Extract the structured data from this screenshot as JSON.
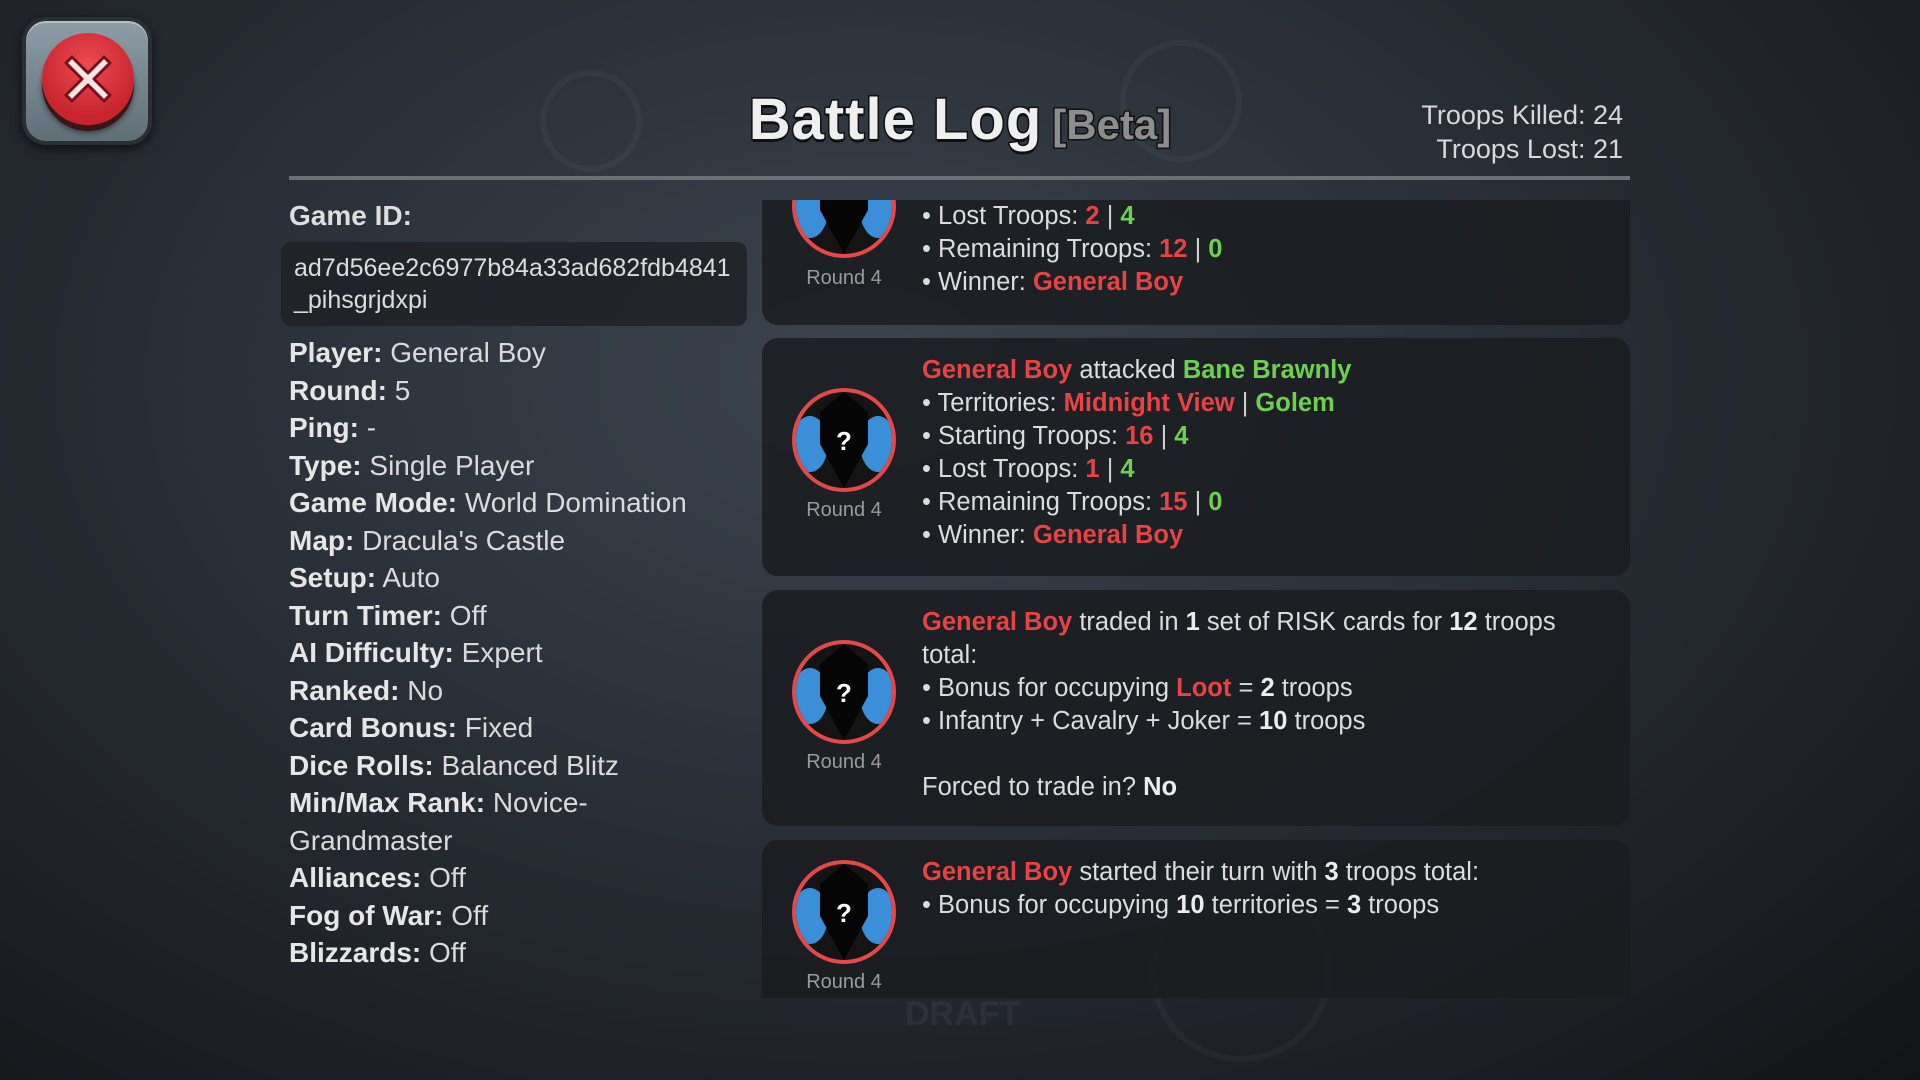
{
  "header": {
    "title": "Battle Log",
    "badge": "[Beta]",
    "troops_killed": "Troops Killed: 24",
    "troops_lost": "Troops Lost: 21"
  },
  "close_button": {
    "icon": "close-icon",
    "label": "Close"
  },
  "game": {
    "id_label": "Game ID:",
    "id_value": "ad7d56ee2c6977b84a33ad682fdb4841_pihsgrjdxpi",
    "info": [
      {
        "label": "Player:",
        "value": "General Boy"
      },
      {
        "label": "Round:",
        "value": "5"
      },
      {
        "label": "Ping:",
        "value": "-"
      },
      {
        "label": "Type:",
        "value": "Single Player"
      },
      {
        "label": "Game Mode:",
        "value": "World Domination"
      },
      {
        "label": "Map:",
        "value": "Dracula's Castle"
      },
      {
        "label": "Setup:",
        "value": "Auto"
      },
      {
        "label": "Turn Timer:",
        "value": "Off"
      },
      {
        "label": "AI Difficulty:",
        "value": "Expert"
      },
      {
        "label": "Ranked:",
        "value": "No"
      },
      {
        "label": "Card Bonus:",
        "value": "Fixed"
      },
      {
        "label": "Dice Rolls:",
        "value": "Balanced Blitz"
      },
      {
        "label": "Min/Max Rank:",
        "value": "Novice-Grandmaster"
      },
      {
        "label": "Alliances:",
        "value": "Off"
      },
      {
        "label": "Fog of War:",
        "value": "Off"
      },
      {
        "label": "Blizzards:",
        "value": "Off"
      }
    ]
  },
  "colors": {
    "attacker": "#e84343",
    "defender": "#6cd14f",
    "avatar_ring": "#e44848"
  },
  "log": {
    "entries": [
      {
        "round": "Round 4",
        "lost_label": "• Lost Troops: ",
        "lost_a": "2",
        "lost_b": "4",
        "remaining_label": "• Remaining Troops: ",
        "remaining_a": "12",
        "remaining_b": "0",
        "winner_label": "• Winner: ",
        "winner": "General Boy"
      },
      {
        "round": "Round 4",
        "attacker": "General Boy",
        "verb": " attacked ",
        "defender": "Bane Brawnly",
        "territories_label": "• Territories: ",
        "territory_a": "Midnight View",
        "territory_b": "Golem",
        "starting_label": "• Starting Troops: ",
        "starting_a": "16",
        "starting_b": "4",
        "lost_label": "• Lost Troops: ",
        "lost_a": "1",
        "lost_b": "4",
        "remaining_label": "• Remaining Troops: ",
        "remaining_a": "15",
        "remaining_b": "0",
        "winner_label": "• Winner: ",
        "winner": "General Boy",
        "sep": " | "
      },
      {
        "round": "Round 4",
        "player": "General Boy",
        "t1": " traded in ",
        "sets": "1",
        "t2": " set of RISK cards for ",
        "troops": "12",
        "t3": " troops total:",
        "bonus_label": "• Bonus for occupying ",
        "territory": "Loot",
        "bonus_eq": " = ",
        "bonus_troops": "2",
        "bonus_unit": " troops",
        "combo_label": "• Infantry + Cavalry + Joker = ",
        "combo_troops": "10",
        "combo_unit": " troops",
        "forced_label": "Forced to trade in? ",
        "forced_value": "No"
      },
      {
        "round": "Round 4",
        "player": "General Boy",
        "t1": " started their turn with ",
        "troops": "3",
        "t2": " troops total:",
        "bonus_label": "• Bonus for occupying ",
        "territories": "10",
        "bonus_mid": " territories = ",
        "bonus_troops": "3",
        "bonus_unit": " troops"
      }
    ]
  }
}
